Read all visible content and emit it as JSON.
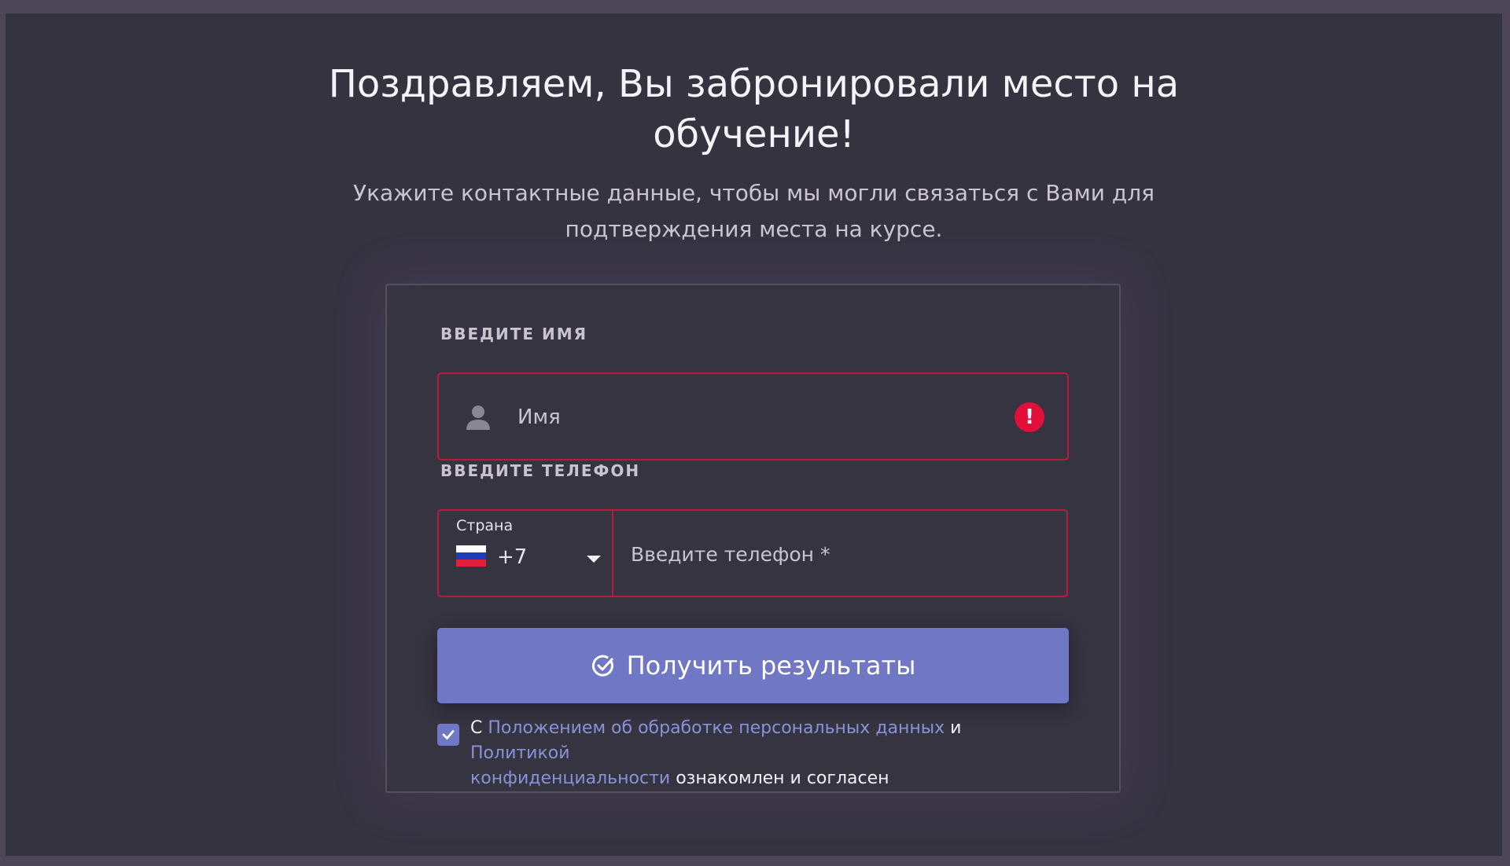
{
  "heading": {
    "line1": "Поздравляем, Вы забронировали место на",
    "line2": "обучение!"
  },
  "subheading": {
    "line1": "Укажите контактные данные, чтобы мы могли связаться с Вами для",
    "line2": "подтверждения места на курсе."
  },
  "form": {
    "name_label": "ВВЕДИТЕ ИМЯ",
    "name_placeholder": "Имя",
    "name_value": "",
    "phone_label": "ВВЕДИТЕ ТЕЛЕФОН",
    "country_label": "Страна",
    "country_code": "+7",
    "country_flag": "russia-flag-icon",
    "phone_placeholder": "Введите телефон *",
    "phone_value": "",
    "submit_label": "Получить результаты",
    "consent": {
      "checked": true,
      "prefix": "С",
      "link1": "Положением об обработке персональных данных",
      "middle": "и",
      "link2_part1": "Политикой",
      "link2_part2": "конфиденциальности",
      "suffix": "ознакомлен и согласен"
    }
  },
  "icons": {
    "user": "person-icon",
    "error": "error-icon",
    "dropdown": "caret-down-icon",
    "submit": "check-circle-icon",
    "checkbox": "checkmark-icon"
  },
  "colors": {
    "page_bg": "#363341",
    "card_border": "#54505e",
    "error_border": "#b81c3c",
    "error_icon": "#e0103a",
    "accent": "#7078c5",
    "link": "#8a91d8"
  }
}
